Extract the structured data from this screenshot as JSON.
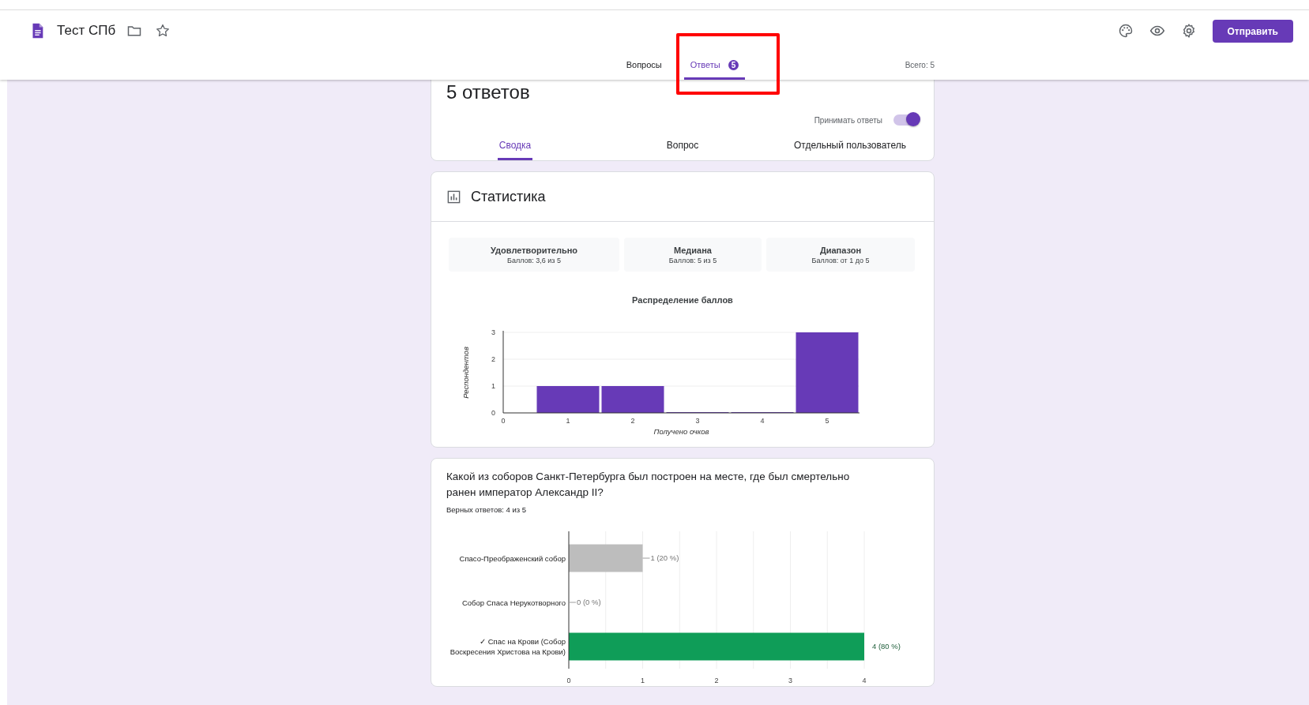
{
  "header": {
    "title": "Тест СПб",
    "send_button": "Отправить"
  },
  "tabs": [
    {
      "label": "Вопросы",
      "selected": false,
      "highlighted": false
    },
    {
      "label": "Ответы",
      "selected": true,
      "highlighted": true,
      "badge": "5"
    }
  ],
  "total": "Всего: 5",
  "responses": {
    "heading": "5 ответов",
    "accepting_label": "Принимать ответы",
    "accepting": true,
    "views": [
      {
        "label": "Сводка",
        "selected": true
      },
      {
        "label": "Вопрос",
        "selected": false
      },
      {
        "label": "Отдельный пользователь",
        "selected": false
      }
    ]
  },
  "statistics": {
    "title": "Статистика",
    "stats": [
      {
        "label": "Удовлетворительно",
        "value": "Баллов: 3,6 из 5"
      },
      {
        "label": "Медиана",
        "value": "Баллов: 5 из 5"
      },
      {
        "label": "Диапазон",
        "value": "Баллов: от 1 до 5"
      }
    ],
    "chart_data": {
      "type": "bar",
      "title": "Распределение баллов",
      "xlabel": "Получено очков",
      "ylabel": "Респондентов",
      "x": [
        1,
        2,
        3,
        4,
        5
      ],
      "grid": true,
      "xlim": [
        0,
        5.5
      ],
      "series": [
        {
          "color": "#673ab7",
          "values": [
            1,
            1,
            0,
            0,
            3
          ]
        }
      ],
      "xticks": [
        0,
        1,
        2,
        3,
        4,
        5
      ],
      "yticks": [
        0,
        1,
        2,
        3
      ],
      "ylim": [
        0,
        3
      ]
    }
  },
  "question": {
    "text": "Какой из соборов Санкт-Петербурга был построен на месте, где был смертельно ранен император Александр II?",
    "correct": "Верных ответов: 4 из 5",
    "chart_data": {
      "type": "bar",
      "orientation": "horizontal",
      "stacked": true,
      "categories": [
        "Спасо-Преображенский собор",
        "Собор Спаса Нерукотворного",
        "✓ Спас на Крови (Собор Воскресения Христова на Крови)"
      ],
      "series": [
        {
          "color": "#bdbdbd",
          "values": [
            1,
            0,
            0
          ]
        },
        {
          "color": "#0f9d58",
          "values": [
            0,
            0,
            4
          ]
        }
      ],
      "xticks": [
        0,
        1,
        2,
        3,
        4
      ],
      "xlim": [
        0,
        4
      ],
      "grid": true,
      "value_labels": [
        "1 (20 %)",
        "0 (0 %)",
        "4 (80 %)"
      ]
    }
  }
}
